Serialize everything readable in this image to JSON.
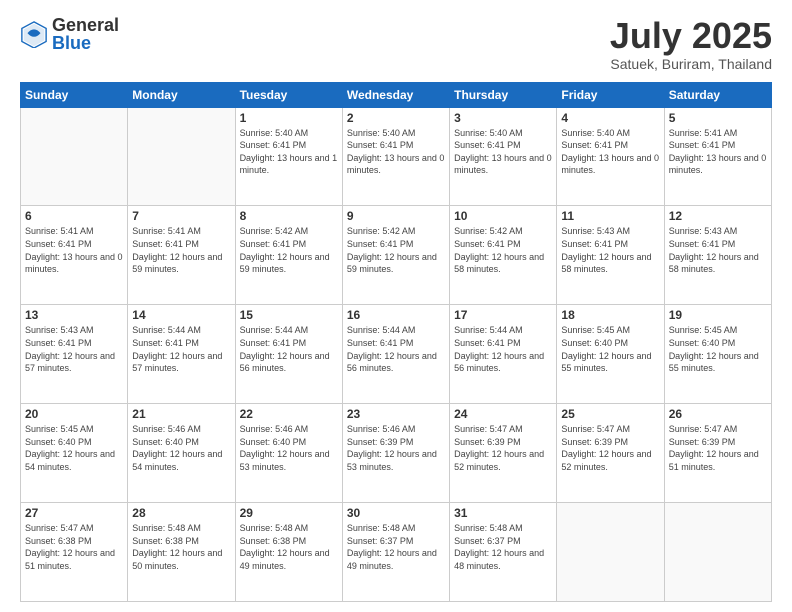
{
  "logo": {
    "general": "General",
    "blue": "Blue"
  },
  "title": "July 2025",
  "location": "Satuek, Buriram, Thailand",
  "days_of_week": [
    "Sunday",
    "Monday",
    "Tuesday",
    "Wednesday",
    "Thursday",
    "Friday",
    "Saturday"
  ],
  "weeks": [
    [
      {
        "day": "",
        "info": ""
      },
      {
        "day": "",
        "info": ""
      },
      {
        "day": "1",
        "info": "Sunrise: 5:40 AM\nSunset: 6:41 PM\nDaylight: 13 hours and 1 minute."
      },
      {
        "day": "2",
        "info": "Sunrise: 5:40 AM\nSunset: 6:41 PM\nDaylight: 13 hours and 0 minutes."
      },
      {
        "day": "3",
        "info": "Sunrise: 5:40 AM\nSunset: 6:41 PM\nDaylight: 13 hours and 0 minutes."
      },
      {
        "day": "4",
        "info": "Sunrise: 5:40 AM\nSunset: 6:41 PM\nDaylight: 13 hours and 0 minutes."
      },
      {
        "day": "5",
        "info": "Sunrise: 5:41 AM\nSunset: 6:41 PM\nDaylight: 13 hours and 0 minutes."
      }
    ],
    [
      {
        "day": "6",
        "info": "Sunrise: 5:41 AM\nSunset: 6:41 PM\nDaylight: 13 hours and 0 minutes."
      },
      {
        "day": "7",
        "info": "Sunrise: 5:41 AM\nSunset: 6:41 PM\nDaylight: 12 hours and 59 minutes."
      },
      {
        "day": "8",
        "info": "Sunrise: 5:42 AM\nSunset: 6:41 PM\nDaylight: 12 hours and 59 minutes."
      },
      {
        "day": "9",
        "info": "Sunrise: 5:42 AM\nSunset: 6:41 PM\nDaylight: 12 hours and 59 minutes."
      },
      {
        "day": "10",
        "info": "Sunrise: 5:42 AM\nSunset: 6:41 PM\nDaylight: 12 hours and 58 minutes."
      },
      {
        "day": "11",
        "info": "Sunrise: 5:43 AM\nSunset: 6:41 PM\nDaylight: 12 hours and 58 minutes."
      },
      {
        "day": "12",
        "info": "Sunrise: 5:43 AM\nSunset: 6:41 PM\nDaylight: 12 hours and 58 minutes."
      }
    ],
    [
      {
        "day": "13",
        "info": "Sunrise: 5:43 AM\nSunset: 6:41 PM\nDaylight: 12 hours and 57 minutes."
      },
      {
        "day": "14",
        "info": "Sunrise: 5:44 AM\nSunset: 6:41 PM\nDaylight: 12 hours and 57 minutes."
      },
      {
        "day": "15",
        "info": "Sunrise: 5:44 AM\nSunset: 6:41 PM\nDaylight: 12 hours and 56 minutes."
      },
      {
        "day": "16",
        "info": "Sunrise: 5:44 AM\nSunset: 6:41 PM\nDaylight: 12 hours and 56 minutes."
      },
      {
        "day": "17",
        "info": "Sunrise: 5:44 AM\nSunset: 6:41 PM\nDaylight: 12 hours and 56 minutes."
      },
      {
        "day": "18",
        "info": "Sunrise: 5:45 AM\nSunset: 6:40 PM\nDaylight: 12 hours and 55 minutes."
      },
      {
        "day": "19",
        "info": "Sunrise: 5:45 AM\nSunset: 6:40 PM\nDaylight: 12 hours and 55 minutes."
      }
    ],
    [
      {
        "day": "20",
        "info": "Sunrise: 5:45 AM\nSunset: 6:40 PM\nDaylight: 12 hours and 54 minutes."
      },
      {
        "day": "21",
        "info": "Sunrise: 5:46 AM\nSunset: 6:40 PM\nDaylight: 12 hours and 54 minutes."
      },
      {
        "day": "22",
        "info": "Sunrise: 5:46 AM\nSunset: 6:40 PM\nDaylight: 12 hours and 53 minutes."
      },
      {
        "day": "23",
        "info": "Sunrise: 5:46 AM\nSunset: 6:39 PM\nDaylight: 12 hours and 53 minutes."
      },
      {
        "day": "24",
        "info": "Sunrise: 5:47 AM\nSunset: 6:39 PM\nDaylight: 12 hours and 52 minutes."
      },
      {
        "day": "25",
        "info": "Sunrise: 5:47 AM\nSunset: 6:39 PM\nDaylight: 12 hours and 52 minutes."
      },
      {
        "day": "26",
        "info": "Sunrise: 5:47 AM\nSunset: 6:39 PM\nDaylight: 12 hours and 51 minutes."
      }
    ],
    [
      {
        "day": "27",
        "info": "Sunrise: 5:47 AM\nSunset: 6:38 PM\nDaylight: 12 hours and 51 minutes."
      },
      {
        "day": "28",
        "info": "Sunrise: 5:48 AM\nSunset: 6:38 PM\nDaylight: 12 hours and 50 minutes."
      },
      {
        "day": "29",
        "info": "Sunrise: 5:48 AM\nSunset: 6:38 PM\nDaylight: 12 hours and 49 minutes."
      },
      {
        "day": "30",
        "info": "Sunrise: 5:48 AM\nSunset: 6:37 PM\nDaylight: 12 hours and 49 minutes."
      },
      {
        "day": "31",
        "info": "Sunrise: 5:48 AM\nSunset: 6:37 PM\nDaylight: 12 hours and 48 minutes."
      },
      {
        "day": "",
        "info": ""
      },
      {
        "day": "",
        "info": ""
      }
    ]
  ]
}
